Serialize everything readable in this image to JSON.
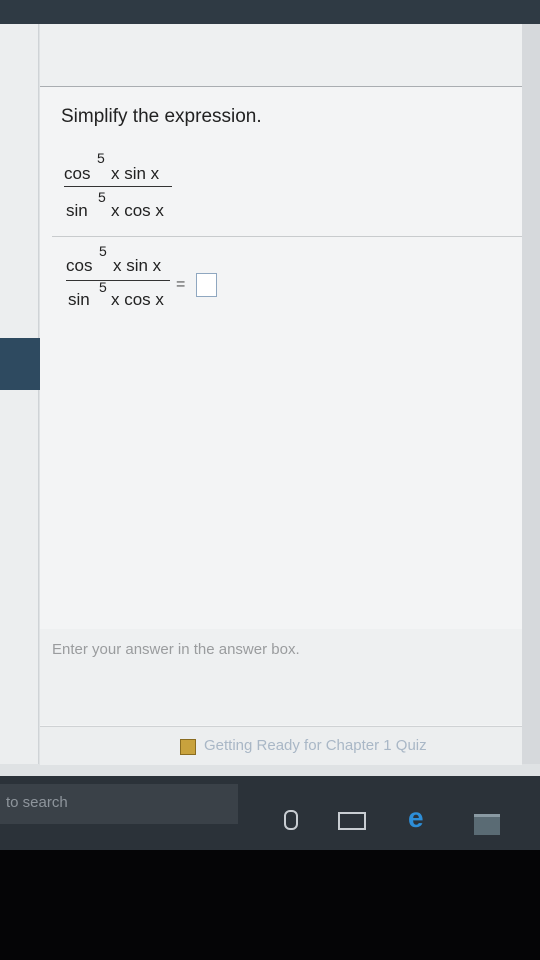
{
  "question": {
    "prompt": "Simplify the expression.",
    "expression": {
      "num_func": "cos",
      "num_exp": "5",
      "num_rest": "x sin x",
      "den_func": "sin",
      "den_exp": "5",
      "den_rest": "x cos x"
    },
    "answer_expression": {
      "num_func": "cos",
      "num_exp": "5",
      "num_rest": "x sin x",
      "den_func": "sin",
      "den_exp": "5",
      "den_rest": "x cos x",
      "equals": "="
    },
    "hint": "Enter your answer in the answer box."
  },
  "quiz_link": {
    "label": "Getting Ready for Chapter 1 Quiz"
  },
  "taskbar": {
    "search_placeholder": "to search"
  },
  "icons": {
    "microphone": "mic-icon",
    "task_view": "task-view-icon",
    "browser": "edge-icon",
    "store": "store-icon"
  },
  "colors": {
    "taskbar": "#2b3239",
    "edge": "#2d8ed8",
    "accent": "#2e4a60"
  }
}
